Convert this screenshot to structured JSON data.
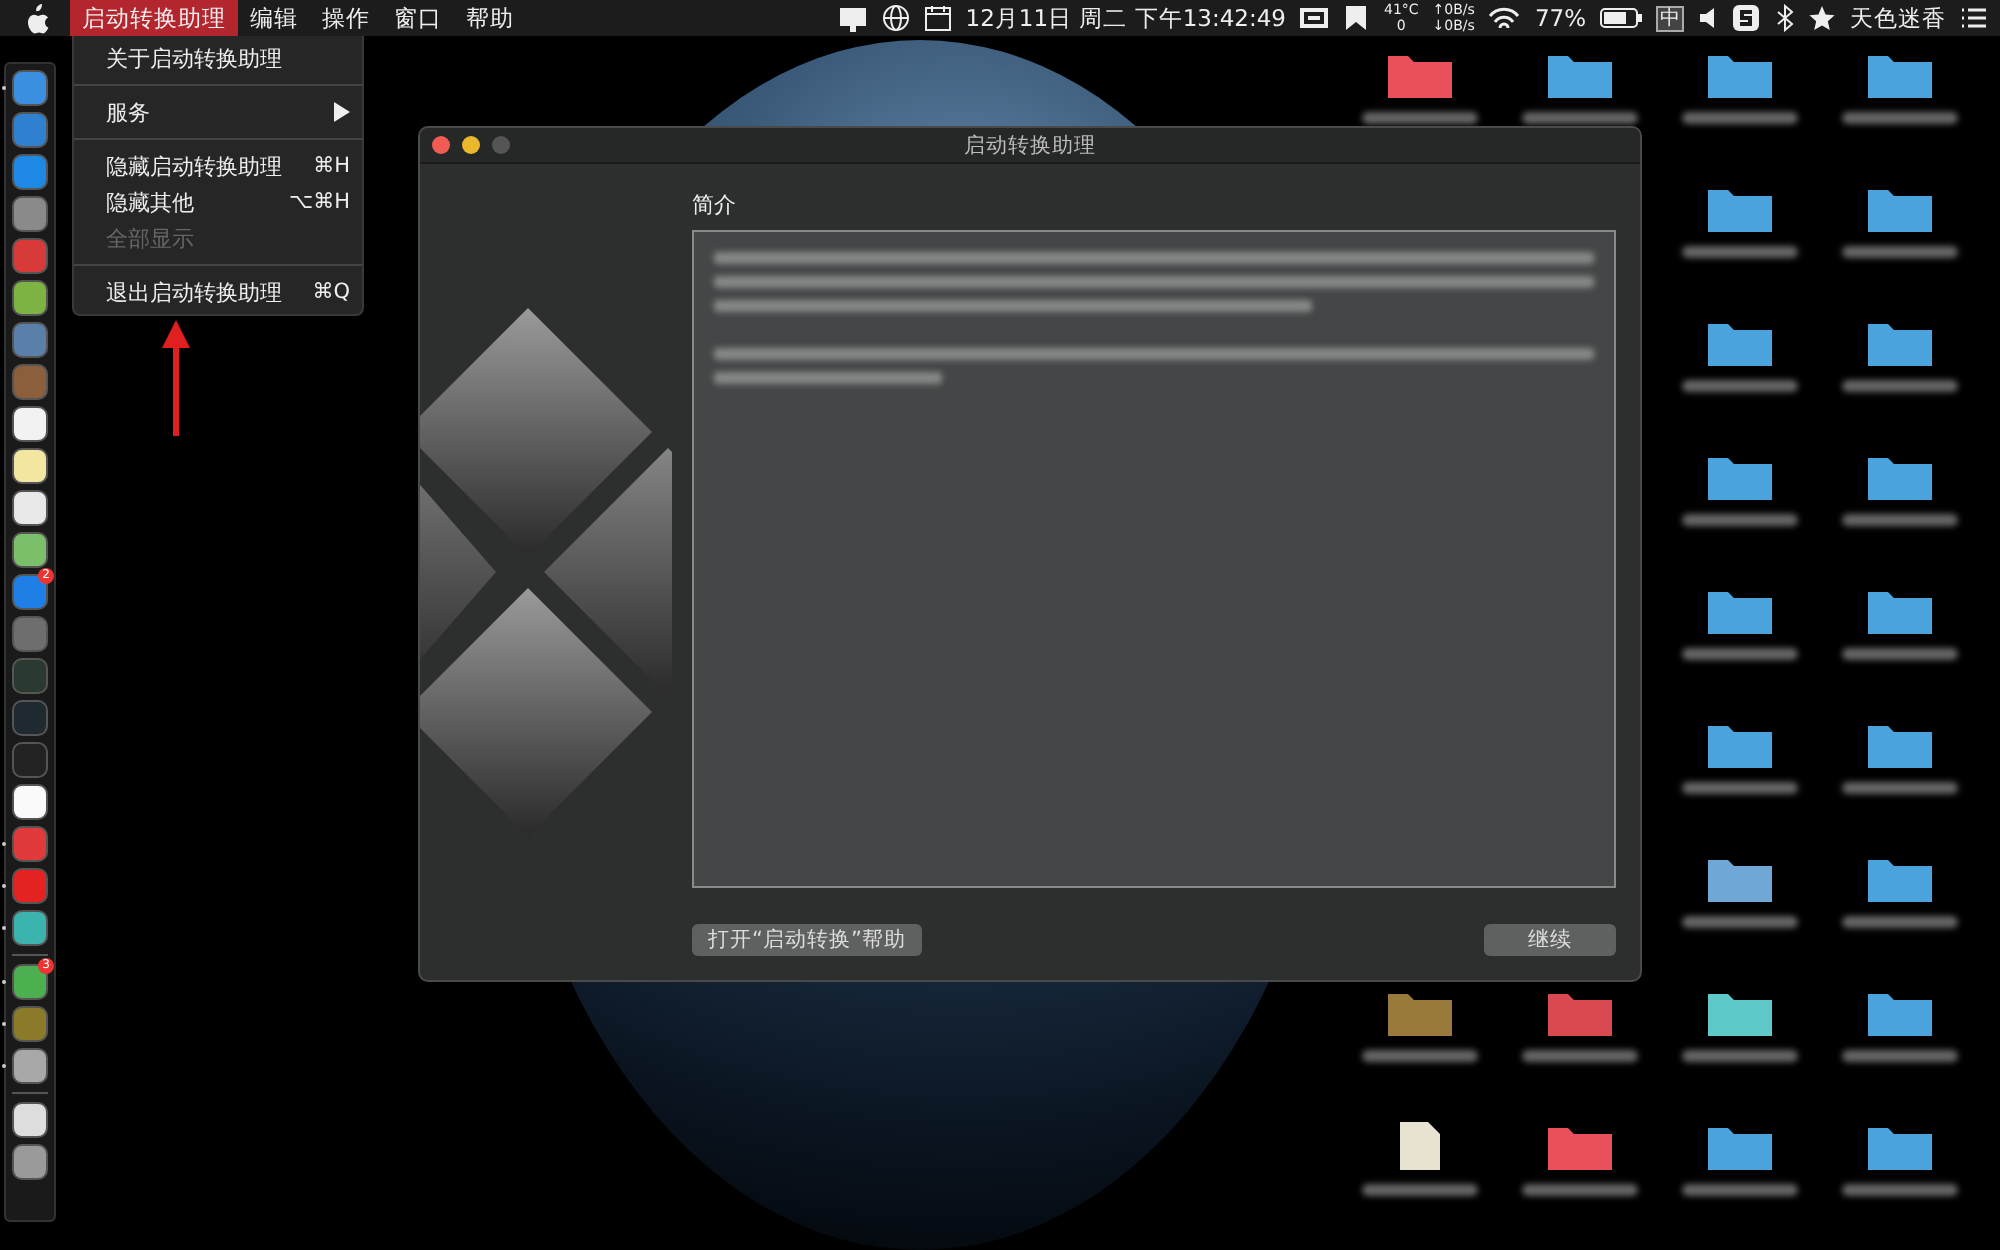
{
  "menubar": {
    "menus": [
      {
        "label": "启动转换助理",
        "selected": true
      },
      {
        "label": "编辑",
        "selected": false
      },
      {
        "label": "操作",
        "selected": false
      },
      {
        "label": "窗口",
        "selected": false
      },
      {
        "label": "帮助",
        "selected": false
      }
    ],
    "clock": "12月11日 周二 下午13:42:49",
    "temperature": "41°C",
    "temperature_sub": "0",
    "net_up": "↑0B/s",
    "net_down": "↓0B/s",
    "battery": "77%",
    "input_method": "中",
    "user": "天色迷香"
  },
  "app_menu": {
    "items": [
      {
        "kind": "item",
        "label": "关于启动转换助理",
        "disabled": false
      },
      {
        "kind": "separator"
      },
      {
        "kind": "submenu",
        "label": "服务",
        "disabled": false
      },
      {
        "kind": "separator"
      },
      {
        "kind": "item",
        "label": "隐藏启动转换助理",
        "shortcut": "⌘H",
        "disabled": false
      },
      {
        "kind": "item",
        "label": "隐藏其他",
        "shortcut": "⌥⌘H",
        "disabled": false
      },
      {
        "kind": "item",
        "label": "全部显示",
        "disabled": true
      },
      {
        "kind": "separator"
      },
      {
        "kind": "item",
        "label": "退出启动转换助理",
        "shortcut": "⌘Q",
        "disabled": false
      }
    ]
  },
  "dock": {
    "items": [
      {
        "kind": "app",
        "color": "#3b8fe0",
        "running": true
      },
      {
        "kind": "app",
        "color": "#2f80d0",
        "running": false
      },
      {
        "kind": "app",
        "color": "#1e88e5",
        "running": false
      },
      {
        "kind": "app",
        "color": "#8a8a8a",
        "running": false
      },
      {
        "kind": "app",
        "color": "#d83a3a",
        "running": false
      },
      {
        "kind": "app",
        "color": "#7cb342",
        "running": false
      },
      {
        "kind": "app",
        "color": "#5a7fa8",
        "running": false
      },
      {
        "kind": "app",
        "color": "#8b5e3c",
        "running": false
      },
      {
        "kind": "app",
        "color": "#f2f2f2",
        "running": false
      },
      {
        "kind": "app",
        "color": "#f3e6a0",
        "running": false
      },
      {
        "kind": "app",
        "color": "#e8e8e8",
        "running": false
      },
      {
        "kind": "app",
        "color": "#7bbf6a",
        "running": false
      },
      {
        "kind": "app",
        "color": "#1e7fe6",
        "running": false,
        "badge": "2"
      },
      {
        "kind": "app",
        "color": "#6e6e6e",
        "running": false
      },
      {
        "kind": "app",
        "color": "#2a3a30",
        "running": false
      },
      {
        "kind": "app",
        "color": "#1f2a30",
        "running": false
      },
      {
        "kind": "app",
        "color": "#222222",
        "running": false
      },
      {
        "kind": "app",
        "color": "#fafafa",
        "running": false
      },
      {
        "kind": "app",
        "color": "#e03a3a",
        "running": true
      },
      {
        "kind": "app",
        "color": "#e52222",
        "running": true
      },
      {
        "kind": "app",
        "color": "#3bb4b0",
        "running": true
      },
      {
        "kind": "separator"
      },
      {
        "kind": "app",
        "color": "#4caf50",
        "running": true,
        "badge": "3"
      },
      {
        "kind": "app",
        "color": "#8a7a2a",
        "running": true
      },
      {
        "kind": "app",
        "color": "#a8a8a8",
        "running": true
      },
      {
        "kind": "separator"
      },
      {
        "kind": "app",
        "color": "#dddddd",
        "running": false
      },
      {
        "kind": "app",
        "color": "#9a9a9a",
        "running": false
      }
    ]
  },
  "desktop_items": [
    {
      "kind": "folder",
      "color": "#e8505a"
    },
    {
      "kind": "folder",
      "color": "#4aa3dc"
    },
    {
      "kind": "folder",
      "color": "#4aa3dc"
    },
    {
      "kind": "folder",
      "color": "#4aa3dc"
    },
    {
      "kind": "none"
    },
    {
      "kind": "none"
    },
    {
      "kind": "folder",
      "color": "#4aa3dc"
    },
    {
      "kind": "folder",
      "color": "#4aa3dc"
    },
    {
      "kind": "none"
    },
    {
      "kind": "none"
    },
    {
      "kind": "folder",
      "color": "#4aa3dc"
    },
    {
      "kind": "folder",
      "color": "#4aa3dc"
    },
    {
      "kind": "none"
    },
    {
      "kind": "none"
    },
    {
      "kind": "folder",
      "color": "#4aa3dc"
    },
    {
      "kind": "folder",
      "color": "#4aa3dc"
    },
    {
      "kind": "none"
    },
    {
      "kind": "none"
    },
    {
      "kind": "folder",
      "color": "#4aa3dc"
    },
    {
      "kind": "folder",
      "color": "#4aa3dc"
    },
    {
      "kind": "none"
    },
    {
      "kind": "none"
    },
    {
      "kind": "folder",
      "color": "#4aa3dc"
    },
    {
      "kind": "folder",
      "color": "#4aa3dc"
    },
    {
      "kind": "none"
    },
    {
      "kind": "none"
    },
    {
      "kind": "folder",
      "color": "#6fa8d6"
    },
    {
      "kind": "folder",
      "color": "#4aa3dc"
    },
    {
      "kind": "folder",
      "color": "#9a7a3a"
    },
    {
      "kind": "folder",
      "color": "#d84a50"
    },
    {
      "kind": "folder",
      "color": "#5fc8c8"
    },
    {
      "kind": "folder",
      "color": "#4aa3dc"
    },
    {
      "kind": "file",
      "color": "#e8e2d0"
    },
    {
      "kind": "folder",
      "color": "#e8505a"
    },
    {
      "kind": "folder",
      "color": "#4aa3dc"
    },
    {
      "kind": "folder",
      "color": "#4aa3dc"
    }
  ],
  "window": {
    "title": "启动转换助理",
    "section": "简介",
    "help_button": "打开“启动转换”帮助",
    "continue_button": "继续"
  }
}
